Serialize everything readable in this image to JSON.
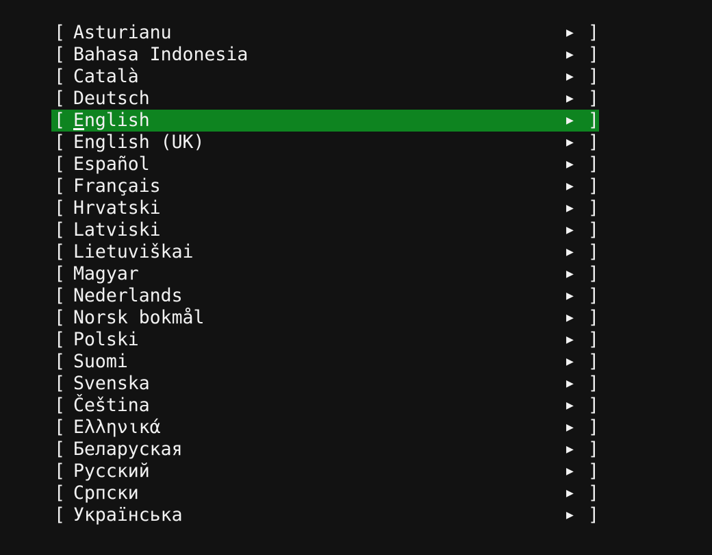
{
  "languages": [
    {
      "label": "Asturianu"
    },
    {
      "label": "Bahasa Indonesia"
    },
    {
      "label": "Català"
    },
    {
      "label": "Deutsch"
    },
    {
      "label": "English",
      "selected": true
    },
    {
      "label": "English (UK)"
    },
    {
      "label": "Español"
    },
    {
      "label": "Français"
    },
    {
      "label": "Hrvatski"
    },
    {
      "label": "Latviski"
    },
    {
      "label": "Lietuviškai"
    },
    {
      "label": "Magyar"
    },
    {
      "label": "Nederlands"
    },
    {
      "label": "Norsk bokmål"
    },
    {
      "label": "Polski"
    },
    {
      "label": "Suomi"
    },
    {
      "label": "Svenska"
    },
    {
      "label": "Čeština"
    },
    {
      "label": "Ελληνικά"
    },
    {
      "label": "Беларуская"
    },
    {
      "label": "Русский"
    },
    {
      "label": "Српски"
    },
    {
      "label": "Українська"
    }
  ],
  "glyphs": {
    "left_bracket": "[",
    "right_bracket": "]",
    "arrow": "▶"
  },
  "colors": {
    "background": "#121212",
    "selection": "#0e8420",
    "text": "#f2f2f2"
  }
}
